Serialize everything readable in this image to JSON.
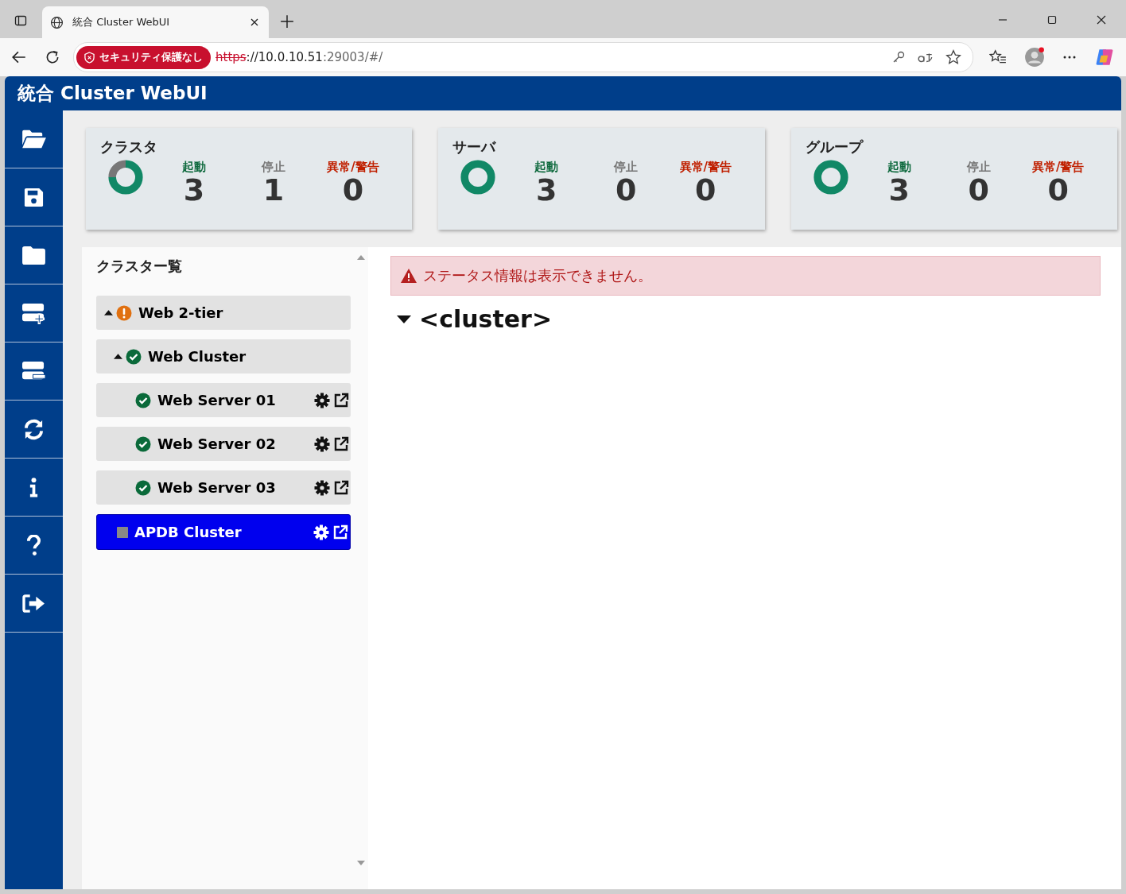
{
  "browser": {
    "tab_title": "統合 Cluster WebUI",
    "security_badge": "セキュリティ保護なし",
    "url": {
      "scheme": "https",
      "host": "://10.0.10.51",
      "rest": ":29003/#/"
    }
  },
  "app": {
    "title": "統合 Cluster WebUI"
  },
  "stats": [
    {
      "title": "クラスタ",
      "labels": [
        "起動",
        "停止",
        "異常/警告"
      ],
      "counts": [
        "3",
        "1",
        "0"
      ]
    },
    {
      "title": "サーバ",
      "labels": [
        "起動",
        "停止",
        "異常/警告"
      ],
      "counts": [
        "3",
        "0",
        "0"
      ]
    },
    {
      "title": "グループ",
      "labels": [
        "起動",
        "停止",
        "異常/警告"
      ],
      "counts": [
        "3",
        "0",
        "0"
      ]
    }
  ],
  "cluster_list": {
    "title": "クラスター覧",
    "items": [
      {
        "label": "Web 2-tier",
        "kind": "warning",
        "expanded": true,
        "selected": false,
        "actions": false,
        "children": [
          {
            "label": "Web Cluster",
            "kind": "ok",
            "expanded": true,
            "selected": false,
            "actions": false,
            "children": [
              {
                "label": "Web Server 01",
                "kind": "ok",
                "selected": false,
                "actions": true
              },
              {
                "label": "Web Server 02",
                "kind": "ok",
                "selected": false,
                "actions": true
              },
              {
                "label": "Web Server 03",
                "kind": "ok",
                "selected": false,
                "actions": true
              }
            ]
          }
        ]
      },
      {
        "label": "APDB Cluster",
        "kind": "stopped",
        "selected": true,
        "actions": true
      }
    ]
  },
  "alert": "ステータス情報は表示できません。",
  "detail": {
    "title": "<cluster>",
    "expanded": true
  }
}
